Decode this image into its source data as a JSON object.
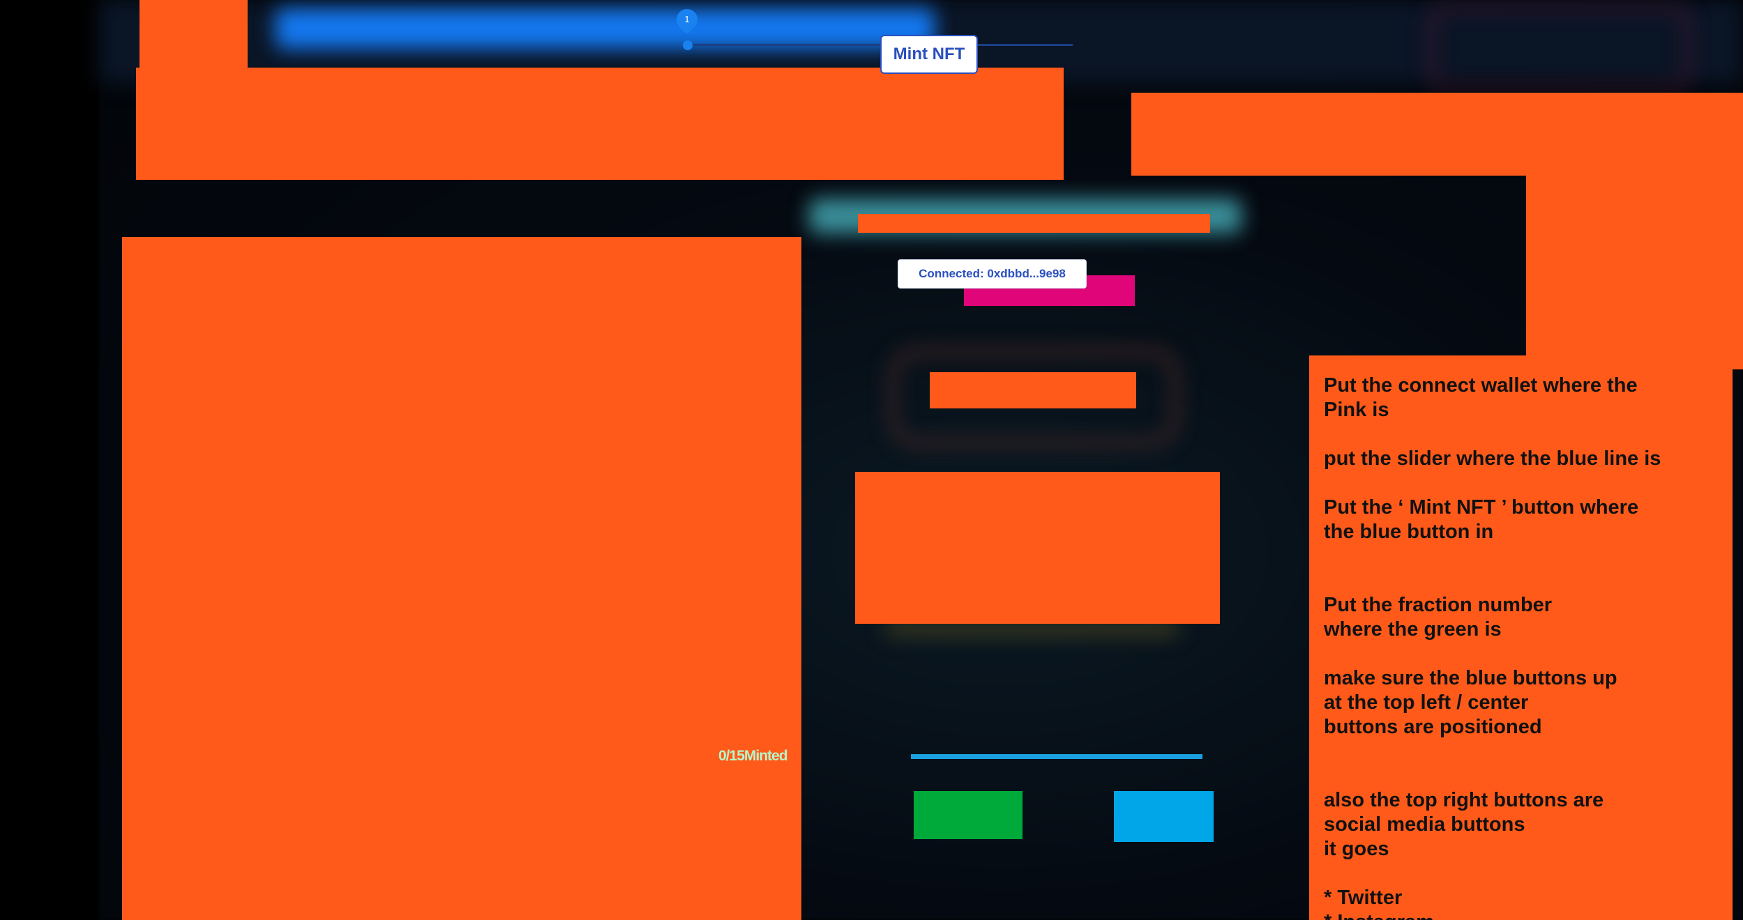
{
  "slider": {
    "handle_label": "1"
  },
  "mint_button": {
    "label": "Mint NFT"
  },
  "wallet": {
    "connected_label": "Connected: 0xdbbd...9e98"
  },
  "counter": {
    "minted_text": "0/15Minted"
  },
  "notes": {
    "lines": [
      "Put the connect wallet where the\nPink is",
      "put the slider where the blue line is",
      "Put the ‘ Mint NFT ’ button where\nthe blue button in",
      "Put the fraction number\nwhere the green is",
      "make sure the blue buttons up\nat the top left / center\nbuttons are positioned",
      "also the top right buttons are\nsocial media buttons\nit goes",
      "* Twitter\n* Instagram"
    ]
  },
  "colors": {
    "annotation_orange": "#ff5a1a",
    "wallet_marker_pink": "#e0067a",
    "slider_line_blue": "#1a9fe0",
    "fraction_marker_green": "#00aa3a",
    "mint_marker_blue": "#00a6e8"
  }
}
